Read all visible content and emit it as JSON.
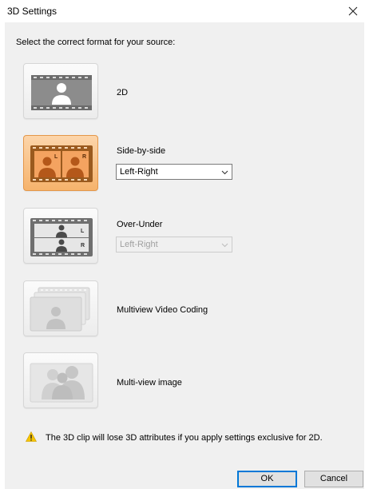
{
  "window": {
    "title": "3D Settings"
  },
  "instruction": "Select the correct format for your source:",
  "options": [
    {
      "label": "2D",
      "selected": false
    },
    {
      "label": "Side-by-side",
      "selected": true
    },
    {
      "label": "Over-Under",
      "selected": false
    },
    {
      "label": "Multiview Video Coding",
      "selected": false
    },
    {
      "label": "Multi-view image",
      "selected": false
    }
  ],
  "side_by_side_dropdown": {
    "value": "Left-Right",
    "enabled": true
  },
  "over_under_dropdown": {
    "value": "Left-Right",
    "enabled": false
  },
  "stereo_markers": {
    "left": "L",
    "right": "R"
  },
  "warning": "The 3D clip will lose 3D attributes if you apply settings exclusive for 2D.",
  "buttons": {
    "ok": "OK",
    "cancel": "Cancel"
  },
  "colors": {
    "selected_accent": "#f6a25a",
    "focus_border": "#0078d7",
    "warning_yellow": "#f5c400"
  }
}
